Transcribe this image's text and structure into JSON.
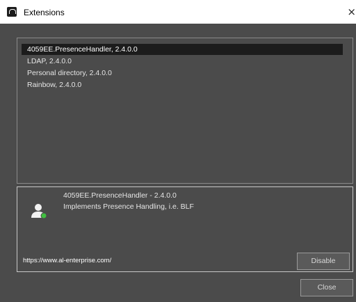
{
  "window": {
    "title": "Extensions",
    "close_glyph": "×"
  },
  "extensions": [
    {
      "label": "4059EE.PresenceHandler, 2.4.0.0",
      "selected": true
    },
    {
      "label": "LDAP, 2.4.0.0",
      "selected": false
    },
    {
      "label": "Personal directory, 2.4.0.0",
      "selected": false
    },
    {
      "label": "Rainbow, 2.4.0.0",
      "selected": false
    }
  ],
  "details": {
    "name": "4059EE.PresenceHandler - 2.4.0.0",
    "description": "Implements Presence Handling, i.e. BLF",
    "link": "https://www.al-enterprise.com/",
    "icon": "user-presence-icon",
    "disable_label": "Disable"
  },
  "footer": {
    "close_label": "Close"
  },
  "colors": {
    "background": "#4b4b4b",
    "selection": "#1c1c1c",
    "presence_green": "#3fbf3f"
  }
}
